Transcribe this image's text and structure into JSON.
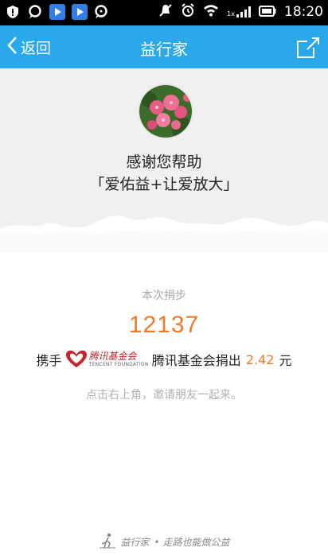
{
  "status_bar": {
    "time": "18:20",
    "signal_label": "1x"
  },
  "app_bar": {
    "back_label": "返回",
    "title": "益行家"
  },
  "hero": {
    "thanks_text": "感谢您帮助",
    "project_text": "「爱佑益+让爱放大」"
  },
  "donation": {
    "steps_label": "本次捐步",
    "steps_value": "12137",
    "prefix": "携手",
    "partner_logo_cn": "腾讯基金会",
    "partner_logo_en": "TENCENT FOUNDATION",
    "partner_name_donated": "腾讯基金会捐出",
    "amount": "2.42",
    "unit": "元",
    "hint": "点击右上角，邀请朋友一起来。"
  },
  "footer": {
    "brand": "益行家",
    "slogan": "• 走路也能做公益"
  },
  "colors": {
    "app_bar": "#29a9ec",
    "accent_orange": "#f07a2a",
    "hero_bg": "#f0f0f0"
  }
}
